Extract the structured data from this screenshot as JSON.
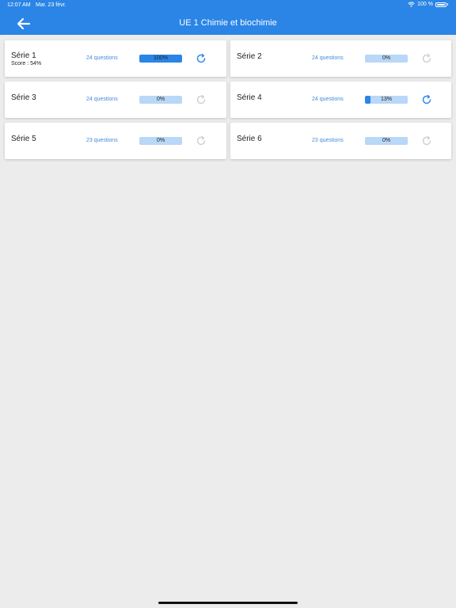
{
  "status": {
    "time": "12:07 AM",
    "date": "Mar. 23 févr.",
    "battery": "100 %"
  },
  "header": {
    "title": "UE 1 Chimie et biochimie",
    "back_icon": "arrow-left-icon"
  },
  "series": [
    {
      "name": "Série 1",
      "score": "Score : 54%",
      "questions": "24 questions",
      "progress_label": "100%",
      "progress": 100,
      "reset_enabled": true
    },
    {
      "name": "Série 2",
      "score": "",
      "questions": "24 questions",
      "progress_label": "0%",
      "progress": 0,
      "reset_enabled": false
    },
    {
      "name": "Série 3",
      "score": "",
      "questions": "24 questions",
      "progress_label": "0%",
      "progress": 0,
      "reset_enabled": false
    },
    {
      "name": "Série 4",
      "score": "",
      "questions": "24 questions",
      "progress_label": "13%",
      "progress": 13,
      "reset_enabled": true
    },
    {
      "name": "Série 5",
      "score": "",
      "questions": "23 questions",
      "progress_label": "0%",
      "progress": 0,
      "reset_enabled": false
    },
    {
      "name": "Série 6",
      "score": "",
      "questions": "23 questions",
      "progress_label": "0%",
      "progress": 0,
      "reset_enabled": false
    }
  ],
  "colors": {
    "accent": "#2a85e6",
    "progress_track": "#b9d7f6",
    "reset_disabled": "#cfcfcf",
    "background": "#ececec"
  }
}
